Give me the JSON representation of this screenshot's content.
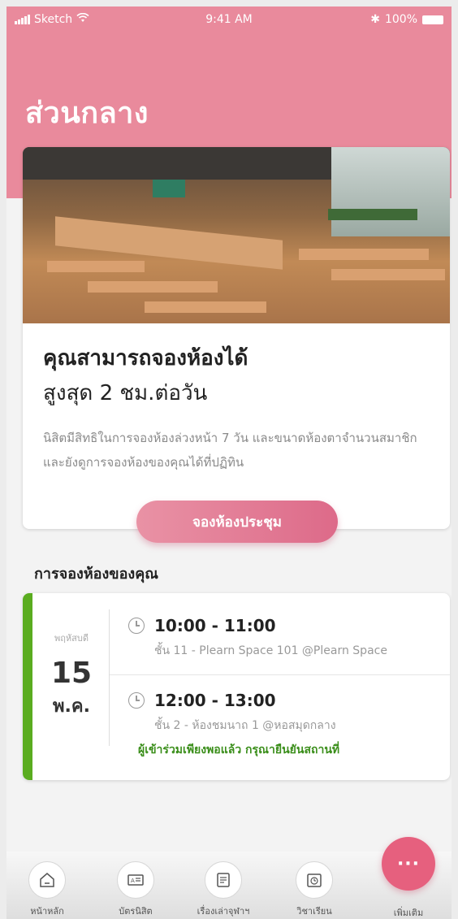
{
  "colors": {
    "brand_pink": "#e98a9c",
    "button_pink": "#dd6a89",
    "status_green": "#5aac1f",
    "note_green": "#3a8e1a"
  },
  "status_bar": {
    "carrier": "Sketch",
    "time": "9:41 AM",
    "battery": "100%"
  },
  "header": {
    "title": "ส่วนกลาง"
  },
  "hero": {
    "heading_line1": "คุณสามารถจองห้องได้",
    "heading_line2": "สูงสุด 2 ชม.ต่อวัน",
    "description": "นิสิตมีสิทธิในการจองห้องล่วงหน้า 7 วัน และขนาดห้องตาจำนวนสมาชิก และยังดูการจองห้องของคุณได้ที่ปฏิทิน",
    "button_label": "จองห้องประชุม"
  },
  "bookings": {
    "section_title": "การจองห้องของคุณ",
    "date": {
      "weekday": "พฤหัสบดี",
      "day": "15",
      "month": "พ.ค."
    },
    "slots": [
      {
        "time": "10:00 - 11:00",
        "location": "ชั้น 11 - Plearn Space 101 @Plearn Space"
      },
      {
        "time": "12:00 - 13:00",
        "location": "ชั้น 2 - ห้องชมนาถ 1 @หอสมุดกลาง",
        "note": "ผู้เข้าร่วมเพียงพอแล้ว กรุณายืนยันสถานที่"
      }
    ]
  },
  "tab_bar": {
    "items": [
      {
        "label": "หน้าหลัก",
        "icon": "home-icon"
      },
      {
        "label": "บัตรนิสิต",
        "icon": "id-card-icon"
      },
      {
        "label": "เรื่องเล่าจุฬาฯ",
        "icon": "news-icon"
      },
      {
        "label": "วิชาเรียน",
        "icon": "schedule-icon"
      }
    ],
    "more_label": "เพิ่มเติม",
    "more_symbol": "···"
  }
}
